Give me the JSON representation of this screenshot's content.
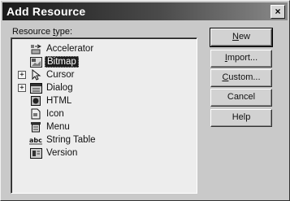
{
  "dialog": {
    "title": "Add Resource",
    "close_glyph": "×"
  },
  "resource_label": {
    "prefix": "Resource ",
    "underline": "t",
    "suffix": "ype:"
  },
  "tree": [
    {
      "label": "Accelerator",
      "icon": "accelerator-icon",
      "expandable": false,
      "selected": false
    },
    {
      "label": "Bitmap",
      "icon": "bitmap-icon",
      "expandable": false,
      "selected": true
    },
    {
      "label": "Cursor",
      "icon": "cursor-icon",
      "expandable": true,
      "selected": false
    },
    {
      "label": "Dialog",
      "icon": "dialog-icon",
      "expandable": true,
      "selected": false
    },
    {
      "label": "HTML",
      "icon": "html-icon",
      "expandable": false,
      "selected": false
    },
    {
      "label": "Icon",
      "icon": "icon-resource-icon",
      "expandable": false,
      "selected": false
    },
    {
      "label": "Menu",
      "icon": "menu-icon",
      "expandable": false,
      "selected": false
    },
    {
      "label": "String Table",
      "icon": "string-table-icon",
      "expandable": false,
      "selected": false
    },
    {
      "label": "Version",
      "icon": "version-icon",
      "expandable": false,
      "selected": false
    }
  ],
  "buttons": {
    "new": {
      "underline": "N",
      "rest": "ew"
    },
    "import": {
      "underline": "I",
      "rest": "mport..."
    },
    "custom": {
      "underline": "C",
      "rest": "ustom..."
    },
    "cancel": {
      "label": "Cancel"
    },
    "help": {
      "label": "Help"
    }
  },
  "expand_glyph": "+"
}
